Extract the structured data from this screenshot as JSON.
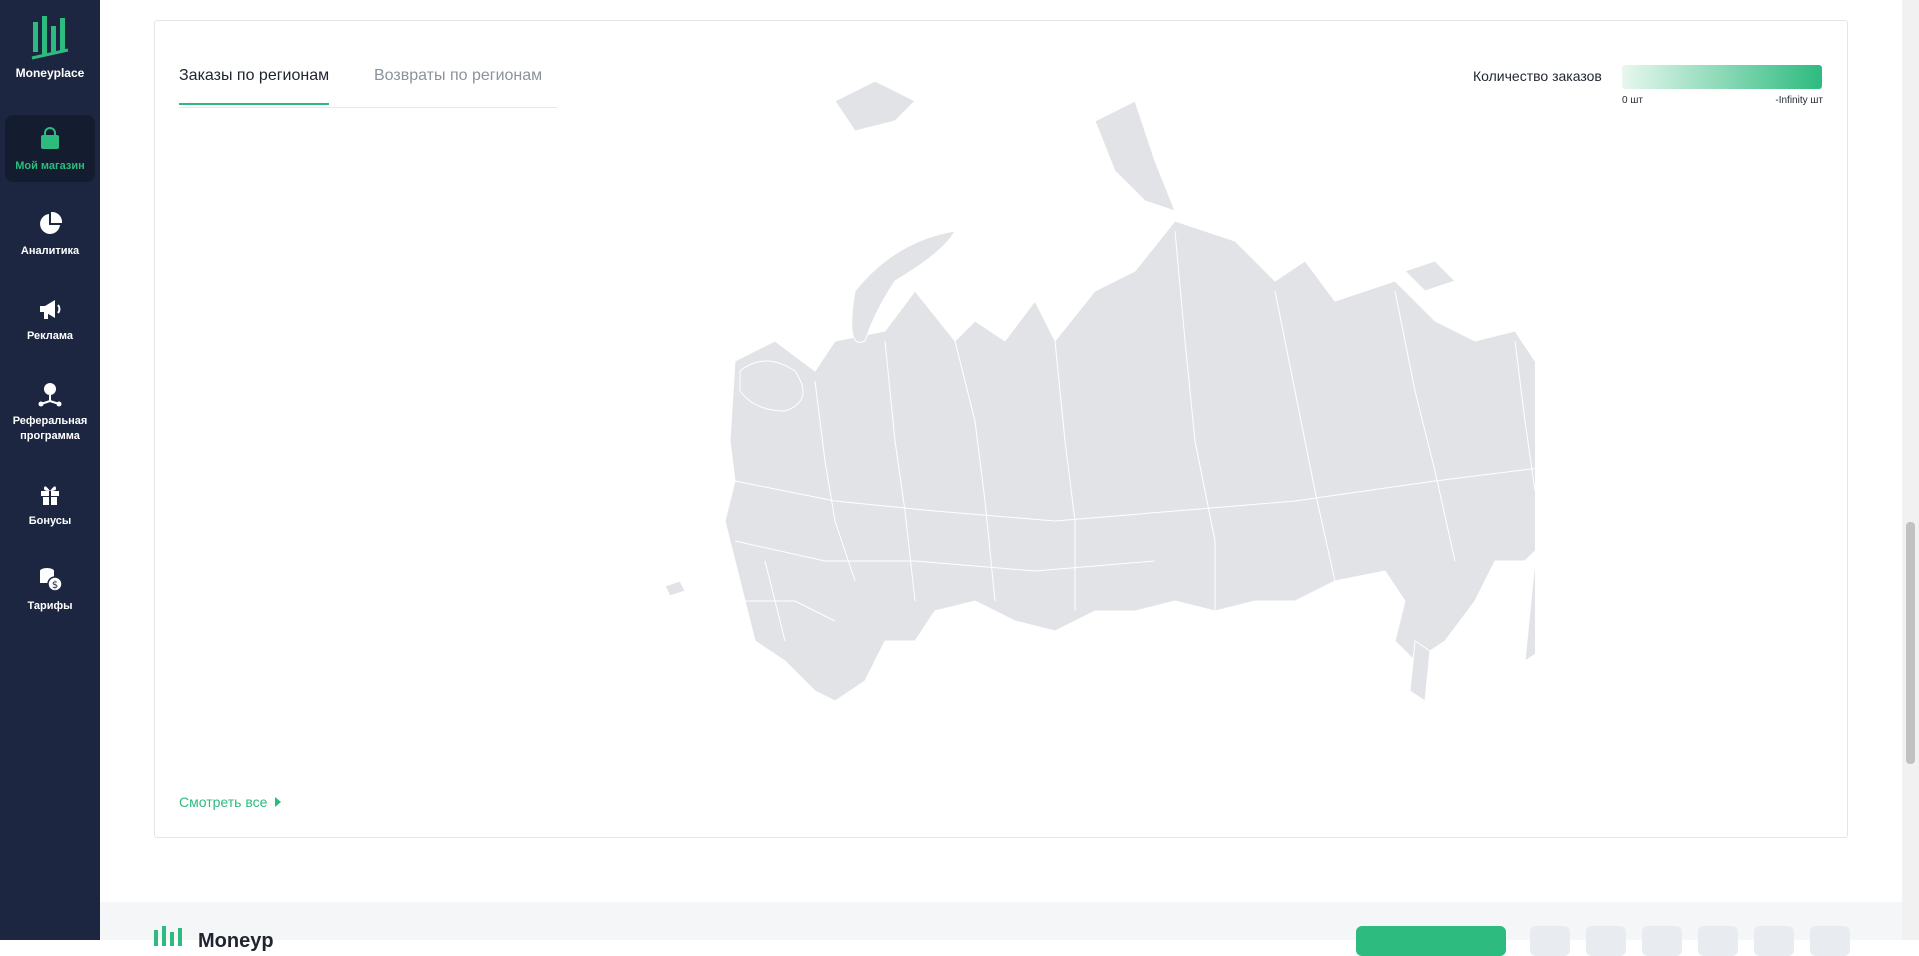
{
  "brand": {
    "name": "Moneyplace",
    "accent": "#2dbb7f",
    "sidebar_bg": "#1c2640"
  },
  "sidebar": {
    "items": [
      {
        "label": "Мой магазин",
        "icon": "shopping-bag-icon",
        "active": true
      },
      {
        "label": "Аналитика",
        "icon": "pie-chart-icon",
        "active": false
      },
      {
        "label": "Реклама",
        "icon": "megaphone-icon",
        "active": false
      },
      {
        "label": "Реферальная программа",
        "icon": "referral-network-icon",
        "active": false
      },
      {
        "label": "Бонусы",
        "icon": "gift-icon",
        "active": false
      },
      {
        "label": "Тарифы",
        "icon": "coins-icon",
        "active": false
      }
    ]
  },
  "card": {
    "tabs": [
      {
        "label": "Заказы по регионам",
        "active": true
      },
      {
        "label": "Возвраты по регионам",
        "active": false
      }
    ],
    "legend": {
      "title": "Количество заказов",
      "min_label": "0 шт",
      "max_label": "-Infinity шт"
    },
    "see_all": "Смотреть все"
  },
  "footer": {
    "brand": "Moneyplace"
  }
}
